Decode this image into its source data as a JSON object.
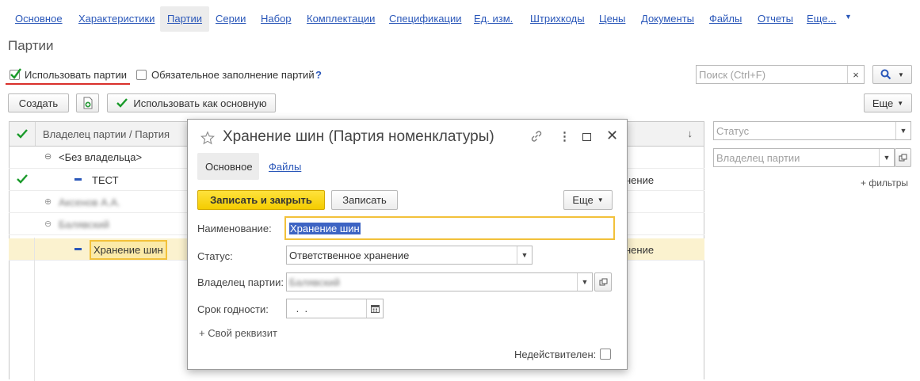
{
  "nav": {
    "tabs": [
      "Основное",
      "Характеристики",
      "Партии",
      "Серии",
      "Набор",
      "Комплектации",
      "Спецификации",
      "Ед. изм.",
      "Штрихкоды",
      "Цены",
      "Документы",
      "Файлы",
      "Отчеты",
      "Еще..."
    ],
    "active": "Партии"
  },
  "page": {
    "title": "Партии"
  },
  "options": {
    "use_batches_label": "Использовать партии",
    "use_batches_checked": true,
    "mandatory_label": "Обязательное заполнение партий",
    "mandatory_checked": false,
    "help": "?"
  },
  "search": {
    "placeholder": "Поиск (Ctrl+F)",
    "clear": "×"
  },
  "toolbar": {
    "create": "Создать",
    "use_main": "Использовать как основную",
    "more": "Еще"
  },
  "list": {
    "header": {
      "owner_batch": "Владелец партии / Партия",
      "sort": "↓"
    },
    "rows": [
      {
        "label": "<Без владельца>",
        "partial": "",
        "blurred": false
      },
      {
        "label": "ТЕСТ",
        "partial": "нение",
        "blurred": false
      },
      {
        "label": "Аксенов А.А.",
        "partial": "",
        "blurred": true
      },
      {
        "label": "Балявский",
        "partial": "",
        "blurred": true
      },
      {
        "label": "Хранение шин",
        "partial": "нение",
        "blurred": false
      }
    ]
  },
  "filters": {
    "status_placeholder": "Статус",
    "owner_placeholder": "Владелец партии",
    "add_filters": "+ фильтры"
  },
  "dialog": {
    "title": "Хранение шин (Партия номенклатуры)",
    "tabs": [
      "Основное",
      "Файлы"
    ],
    "save_close": "Записать и закрыть",
    "save": "Записать",
    "more": "Еще",
    "name_label": "Наименование:",
    "name_value": "Хранение шин",
    "status_label": "Статус:",
    "status_value": "Ответственное хранение",
    "owner_label": "Владелец партии:",
    "owner_value": "Балявский",
    "expiry_label": "Срок годности:",
    "expiry_value": " .  .",
    "add_attr": "+ Свой реквизит",
    "invalid_label": "Недействителен:"
  }
}
